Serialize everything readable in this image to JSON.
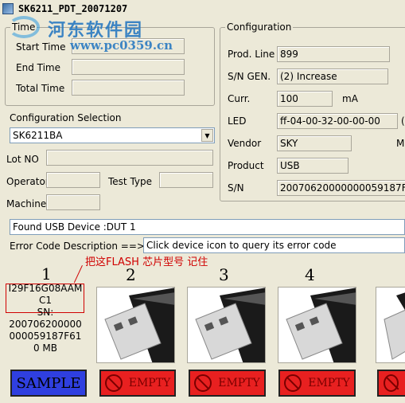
{
  "window": {
    "title": "SK6211_PDT_20071207"
  },
  "watermark": {
    "main": "河东软件园",
    "url": "www.pc0359.cn"
  },
  "time_group": {
    "legend": "Time",
    "start_label": "Start Time",
    "end_label": "End Time",
    "total_label": "Total Time"
  },
  "config_group": {
    "legend": "Configuration",
    "prod_line_label": "Prod. Line",
    "prod_line_value": "899",
    "sn_gen_label": "S/N GEN.",
    "sn_gen_value": "(2) Increase",
    "curr_label": "Curr.",
    "curr_value": "100",
    "curr_unit": "mA",
    "led_label": "LED",
    "led_value": "ff-04-00-32-00-00-00",
    "led_extra": "(",
    "vendor_label": "Vendor",
    "vendor_value": "SKY",
    "vendor_extra": "M",
    "product_label": "Product",
    "product_value": "USB",
    "sn_label": "S/N",
    "sn_value": "20070620000000059187F6"
  },
  "config_selection": {
    "label": "Configuration Selection",
    "value": "SK6211BA"
  },
  "lot_label": "Lot NO",
  "operator_label": "Operator",
  "test_type_label": "Test Type",
  "machine_label": "Machine",
  "status": {
    "message": "Found USB Device :DUT 1"
  },
  "error_code": {
    "label": "Error Code Description ==>",
    "value": "Click device icon to query its error code"
  },
  "annotation": "把这FLASH 芯片型号 记住",
  "slots": [
    {
      "number": "1",
      "flash": "I29F16G08AAM",
      "flash2": "C1",
      "sn_label": "SN:",
      "sn1": "200706200000",
      "sn2": "000059187F61",
      "size": "0 MB",
      "button": "SAMPLE"
    },
    {
      "number": "2",
      "button": "EMPTY"
    },
    {
      "number": "3",
      "button": "EMPTY"
    },
    {
      "number": "4",
      "button": "EMPTY"
    }
  ],
  "colors": {
    "sample_button": "#2f3fe0",
    "empty_button": "#e82020",
    "annotation": "#d00000"
  }
}
